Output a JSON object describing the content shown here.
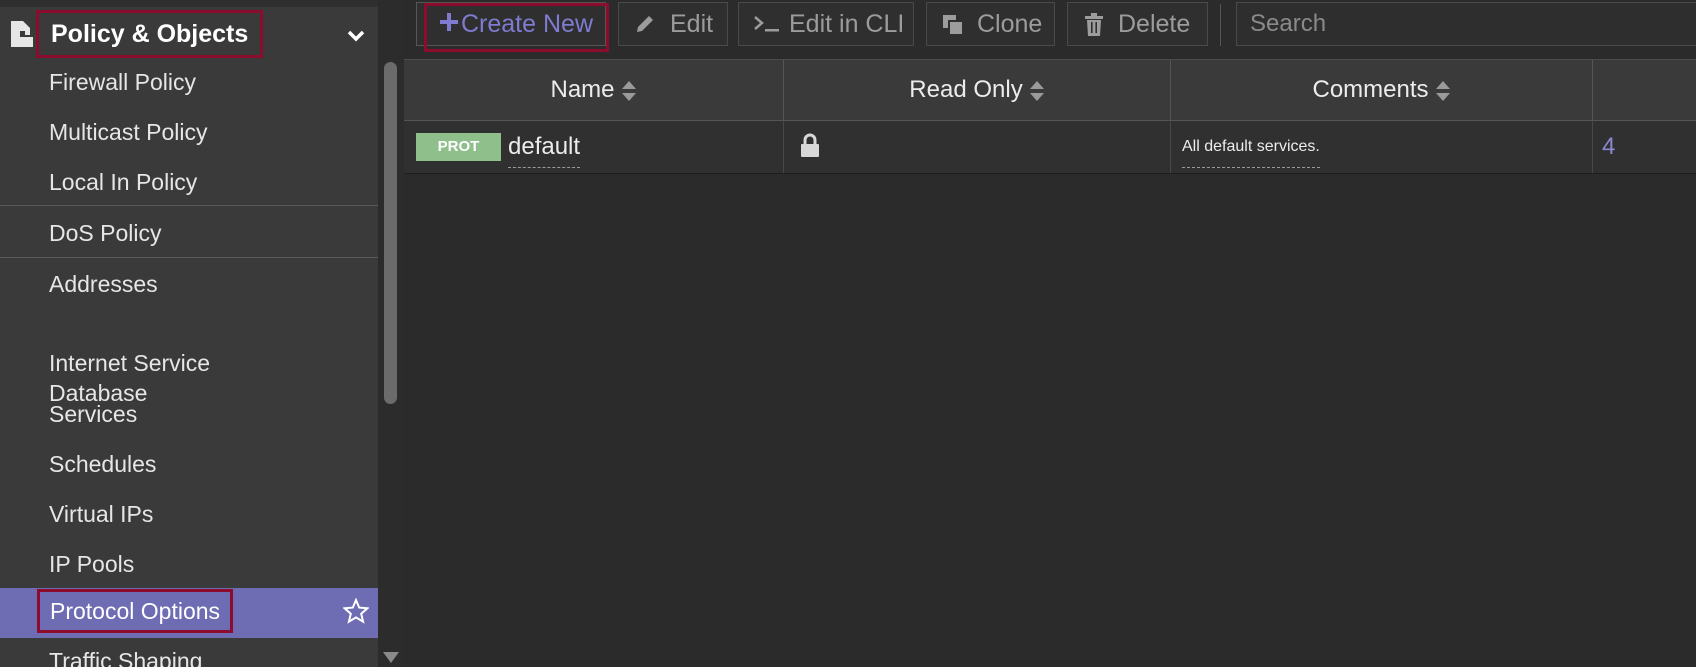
{
  "sidebar": {
    "section_title": "Policy & Objects",
    "section_icon": "document-icon",
    "items": [
      {
        "label": "Firewall Policy"
      },
      {
        "label": "Multicast Policy"
      },
      {
        "label": "Local In Policy"
      },
      {
        "label": "DoS Policy"
      },
      {
        "label": "Addresses"
      },
      {
        "label": "Internet Service\nDatabase"
      },
      {
        "label": "Services"
      },
      {
        "label": "Schedules"
      },
      {
        "label": "Virtual IPs"
      },
      {
        "label": "IP Pools"
      },
      {
        "label": "Protocol Options",
        "active": true
      },
      {
        "label": "Traffic Shaping"
      }
    ]
  },
  "toolbar": {
    "create_new": "Create New",
    "edit": "Edit",
    "edit_in_cli": "Edit in CLI",
    "clone": "Clone",
    "delete": "Delete",
    "search_placeholder": "Search"
  },
  "table": {
    "columns": [
      "Name",
      "Read Only",
      "Comments"
    ],
    "rows": [
      {
        "badge": "PROT",
        "name": "default",
        "read_only_icon": "lock-icon",
        "comments": "All default services.",
        "ref": "4"
      }
    ]
  },
  "colors": {
    "accent": "#6e6cb3",
    "highlight_border": "#8b0c2c",
    "badge_green": "#8fbf8b",
    "link_purple": "#7e7bd0"
  }
}
